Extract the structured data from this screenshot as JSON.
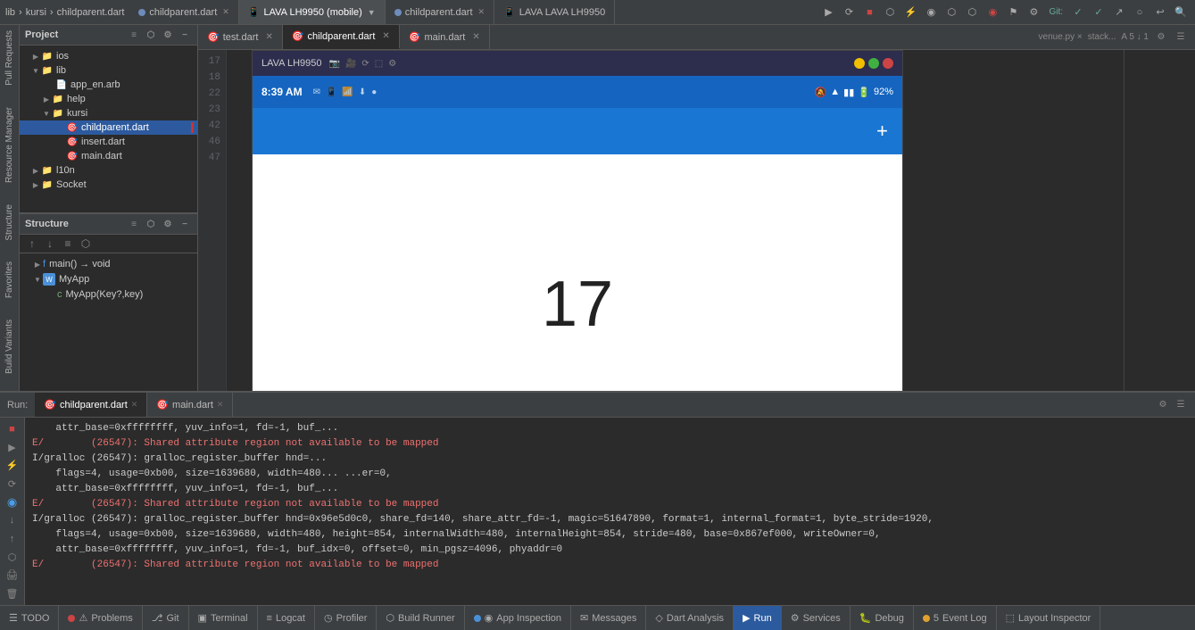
{
  "topbar": {
    "breadcrumb_lib": "lib",
    "breadcrumb_kursi": "kursi",
    "breadcrumb_file": "childparent.dart",
    "tab1_label": "childparent.dart",
    "tab2_label": "LAVA LH9950 (mobile)",
    "tab3_label": "childparent.dart",
    "tab4_label": "LAVA LAVA LH9950",
    "icons": [
      "▶",
      "⟳",
      "⟵",
      "⟳",
      "⚡",
      "◉",
      "⬡",
      "⬡",
      "◉",
      "⚑",
      "⚙",
      "Git:",
      "✓",
      "✓",
      "↗",
      "○",
      "↩",
      "⬡",
      "⬡",
      "⬡",
      "⬡",
      "🔍"
    ]
  },
  "project_panel": {
    "title": "Project",
    "items": [
      {
        "label": "ios",
        "type": "folder",
        "indent": 1,
        "expanded": false
      },
      {
        "label": "lib",
        "type": "folder",
        "indent": 1,
        "expanded": true
      },
      {
        "label": "app_en.arb",
        "type": "arb",
        "indent": 2,
        "expanded": false
      },
      {
        "label": "help",
        "type": "folder",
        "indent": 2,
        "expanded": false
      },
      {
        "label": "kursi",
        "type": "folder",
        "indent": 2,
        "expanded": true
      },
      {
        "label": "childparent.dart",
        "type": "dart",
        "indent": 3,
        "expanded": false,
        "selected": true,
        "modified": true
      },
      {
        "label": "insert.dart",
        "type": "dart",
        "indent": 3,
        "expanded": false
      },
      {
        "label": "main.dart",
        "type": "dart",
        "indent": 3,
        "expanded": false
      },
      {
        "label": "l10n",
        "type": "folder",
        "indent": 1,
        "expanded": false
      },
      {
        "label": "Socket",
        "type": "folder",
        "indent": 1,
        "expanded": false
      }
    ]
  },
  "structure_panel": {
    "title": "Structure",
    "items": [
      {
        "label": "main() → void",
        "type": "function",
        "indent": 1,
        "expanded": false
      },
      {
        "label": "MyApp",
        "type": "widget",
        "indent": 1,
        "expanded": false
      },
      {
        "label": "MyApp(Key?,key)",
        "type": "constructor",
        "indent": 2,
        "expanded": false
      }
    ]
  },
  "editor": {
    "tabs": [
      {
        "label": "test.dart",
        "active": false,
        "modified": false
      },
      {
        "label": "childparent.dart",
        "active": true,
        "modified": true
      },
      {
        "label": "main.dart",
        "active": false,
        "modified": false
      }
    ],
    "line_numbers": [
      "17",
      "18",
      "22",
      "23",
      "42",
      "46",
      "47"
    ]
  },
  "phone": {
    "title": "LAVA LH9950",
    "time": "8:39 AM",
    "battery": "92%",
    "counter": "17",
    "app_bar_icon": "+"
  },
  "run_panel": {
    "label": "Run:",
    "tabs": [
      {
        "label": "childparent.dart",
        "active": true,
        "modified": false
      },
      {
        "label": "main.dart",
        "active": false,
        "modified": false
      }
    ]
  },
  "console": {
    "lines": [
      {
        "text": "    attr_base=0xffffffff, yuv_info=1, fd=-1, buf_...",
        "type": "error"
      },
      {
        "text": "E/        (26547): Shared attribute region not available to be mapped",
        "type": "error"
      },
      {
        "text": "I/gralloc (26547): gralloc_register_buffer hnd=...",
        "type": "info"
      },
      {
        "text": "    flags=4, usage=0xb00, size=1639680, width=480... ...er=0,",
        "type": "info"
      },
      {
        "text": "    attr_base=0xffffffff, yuv_info=1, fd=-1, buf_...",
        "type": "info"
      },
      {
        "text": "E/        (26547): Shared attribute region not available to be mapped",
        "type": "error"
      },
      {
        "text": "I/gralloc (26547): gralloc_register_buffer hnd=0x96e5d0c0, share_fd=140, share_attr_fd=-1, magic=51647890, format=1, internal_format=1, byte_stride=1920,",
        "type": "info"
      },
      {
        "text": "    flags=4, usage=0xb00, size=1639680, width=480, height=854, internalWidth=480, internalHeight=854, stride=480, base=0x867ef000, writeOwner=0,",
        "type": "info"
      },
      {
        "text": "    attr_base=0xffffffff, yuv_info=1, fd=-1, buf_idx=0, offset=0, min_pgsz=4096, phyaddr=0",
        "type": "info"
      },
      {
        "text": "E/        (26547): Shared attribute region not available to be mapped",
        "type": "error"
      }
    ]
  },
  "status_bar": {
    "items": [
      {
        "label": "TODO",
        "icon": "☰",
        "dot": null
      },
      {
        "label": "Problems",
        "icon": "⚠",
        "dot": "red"
      },
      {
        "label": "Git",
        "icon": "⎇",
        "dot": null
      },
      {
        "label": "Terminal",
        "icon": "▣",
        "dot": null
      },
      {
        "label": "Logcat",
        "icon": "≡",
        "dot": null
      },
      {
        "label": "Profiler",
        "icon": "📊",
        "dot": null
      },
      {
        "label": "Build Runner",
        "icon": "⬡",
        "dot": null
      },
      {
        "label": "App Inspection",
        "icon": "◉",
        "dot": "blue"
      },
      {
        "label": "Messages",
        "icon": "✉",
        "dot": null
      },
      {
        "label": "Dart Analysis",
        "icon": "◇",
        "dot": null
      },
      {
        "label": "Run",
        "icon": "▶",
        "dot": null,
        "active": true
      },
      {
        "label": "Services",
        "icon": "⚙",
        "dot": null
      },
      {
        "label": "Debug",
        "icon": "🐛",
        "dot": null
      },
      {
        "label": "Event Log",
        "icon": "📋",
        "dot": "orange"
      },
      {
        "label": "Layout Inspector",
        "icon": "⬚",
        "dot": null
      }
    ]
  },
  "left_vert_labels": [
    "Pull Requests",
    "Resource Manager",
    "Structure",
    "Favorites",
    "Build Variants"
  ]
}
